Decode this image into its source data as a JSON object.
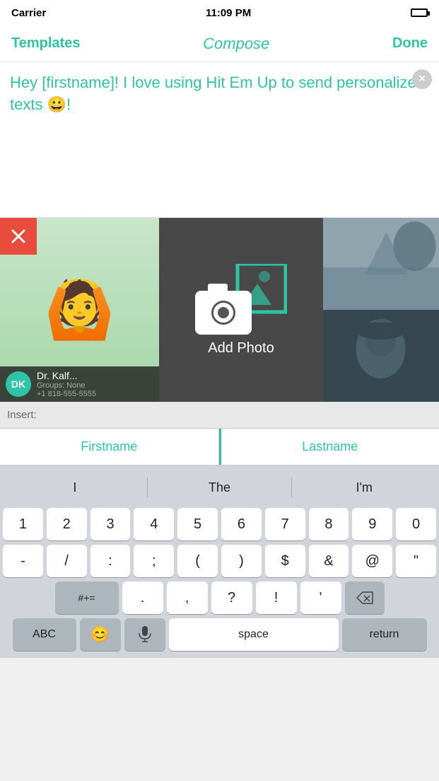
{
  "statusBar": {
    "carrier": "Carrier",
    "wifi": "wifi",
    "time": "11:09 PM",
    "battery": "full"
  },
  "navBar": {
    "templates": "Templates",
    "compose": "Compose",
    "done": "Done"
  },
  "composeArea": {
    "text": "Hey [firstname]! I love using Hit Em Up to send personalized texts 😀!",
    "closeIcon": "×"
  },
  "photoSection": {
    "deleteIcon": "✕",
    "addPhotoLabel": "Add Photo",
    "contactName": "Dr. Kalf...",
    "contactGroups": "Groups: None",
    "contactPhone": "+1 818-555-5555"
  },
  "insertBar": {
    "label": "Insert:"
  },
  "quickInsert": {
    "firstname": "Firstname",
    "lastname": "Lastname"
  },
  "keyboard": {
    "suggestions": [
      "I",
      "The",
      "I'm"
    ],
    "row1": [
      "1",
      "2",
      "3",
      "4",
      "5",
      "6",
      "7",
      "8",
      "9",
      "0"
    ],
    "row2": [
      "-",
      "/",
      ":",
      ";",
      "(",
      ")",
      "$",
      "&",
      "@",
      "\""
    ],
    "row3special": [
      "#+= ",
      ".",
      ",",
      "?",
      "!",
      "'",
      "⌫"
    ],
    "bottomLeft": "ABC",
    "emoji": "😊",
    "mic": "🎤",
    "space": "space",
    "return": "return"
  }
}
